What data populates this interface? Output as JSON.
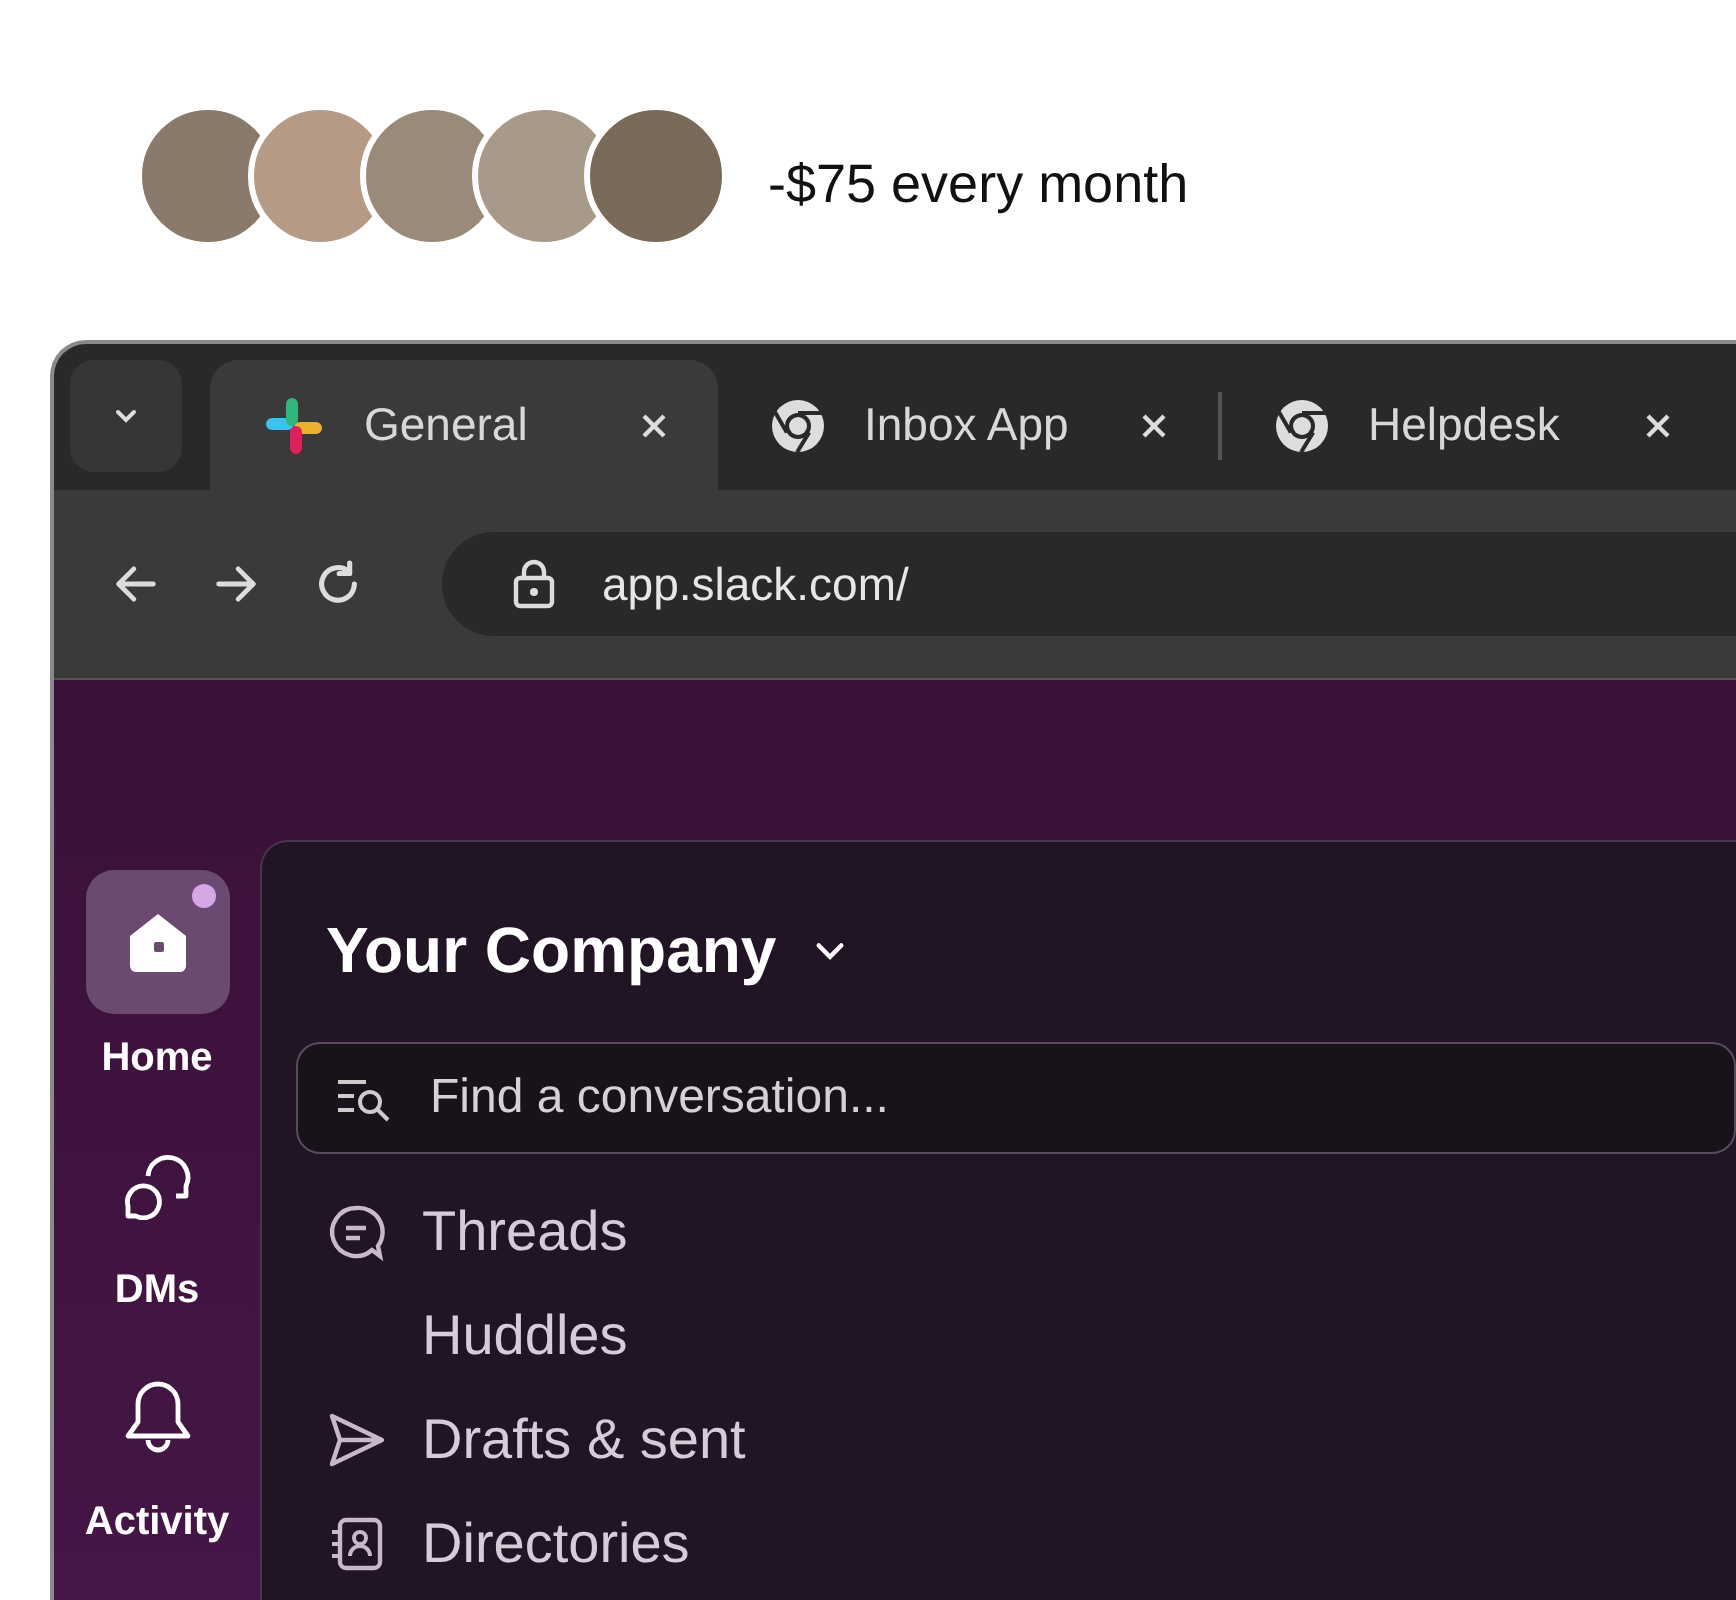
{
  "pricing": {
    "text": "-$75 every month"
  },
  "browser": {
    "tabs": [
      {
        "kind": "slack",
        "title": "General",
        "selected": true
      },
      {
        "kind": "chrome",
        "title": "Inbox App",
        "selected": false
      },
      {
        "kind": "chrome",
        "title": "Helpdesk",
        "selected": false
      }
    ],
    "url": "app.slack.com/"
  },
  "rail": [
    {
      "kind": "home",
      "label": "Home",
      "selected": true,
      "unread": true
    },
    {
      "kind": "dms",
      "label": "DMs",
      "selected": false,
      "unread": false
    },
    {
      "kind": "activity",
      "label": "Activity",
      "selected": false,
      "unread": false
    }
  ],
  "workspace": {
    "name": "Your Company",
    "search": {
      "placeholder": "Find a conversation..."
    },
    "items": [
      {
        "kind": "threads",
        "label": "Threads"
      },
      {
        "kind": "none",
        "label": "Huddles"
      },
      {
        "kind": "drafts",
        "label": "Drafts & sent"
      },
      {
        "kind": "directories",
        "label": "Directories"
      }
    ]
  }
}
